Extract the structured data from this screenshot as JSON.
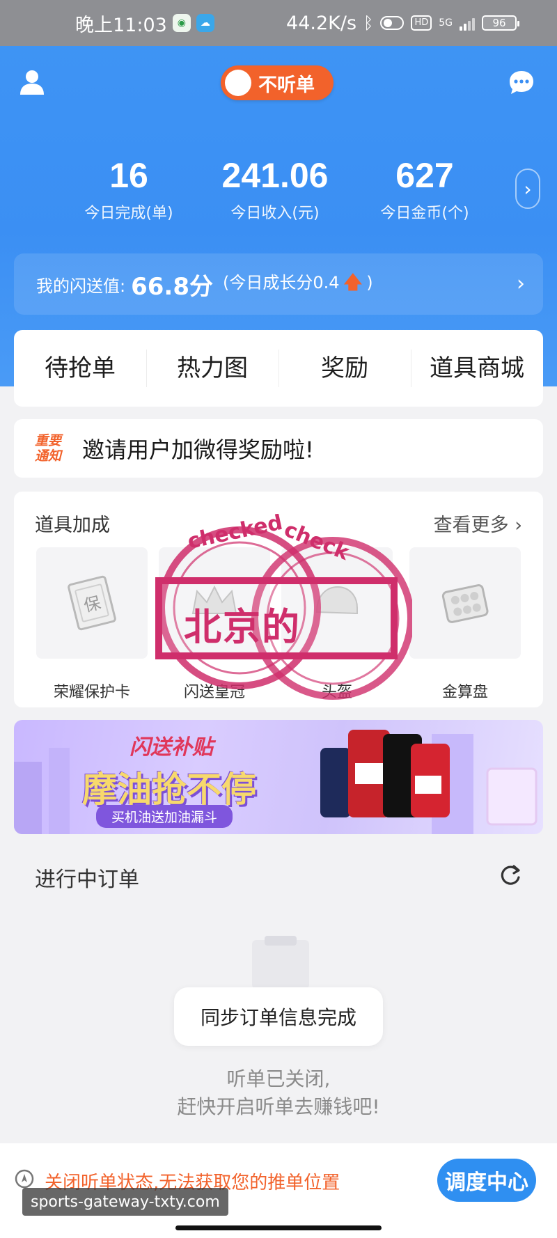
{
  "status_bar": {
    "time": "晚上11:03",
    "network_speed": "44.2K/s",
    "hd_badge": "HD",
    "signal_label": "5G",
    "battery": "96"
  },
  "header": {
    "listen_toggle_label": "不听单"
  },
  "stats": [
    {
      "value": "16",
      "label": "今日完成(单)"
    },
    {
      "value": "241.06",
      "label": "今日收入(元)"
    },
    {
      "value": "627",
      "label": "今日金币(个)"
    }
  ],
  "score": {
    "label": "我的闪送值:",
    "value": "66.8分",
    "growth_prefix": "(今日成长分0.4",
    "growth_suffix": ")"
  },
  "menu": [
    {
      "label": "待抢单"
    },
    {
      "label": "热力图"
    },
    {
      "label": "奖励"
    },
    {
      "label": "道具商城"
    }
  ],
  "notice": {
    "tag_line1": "重要",
    "tag_line2": "通知",
    "text": "邀请用户加微得奖励啦!"
  },
  "props": {
    "title": "道具加成",
    "more": "查看更多",
    "items": [
      {
        "name": "荣耀保护卡",
        "icon": "protection-card-icon"
      },
      {
        "name": "闪送皇冠",
        "icon": "crown-icon"
      },
      {
        "name": "头盔",
        "icon": "helmet-icon"
      },
      {
        "name": "金算盘",
        "icon": "abacus-icon"
      }
    ]
  },
  "stamp": {
    "text": "北京的",
    "ring_text": "checked"
  },
  "banner": {
    "subtitle_top": "闪送补贴",
    "title": "摩油抢不停",
    "subtitle": "买机油送加油漏斗"
  },
  "orders": {
    "title": "进行中订单",
    "toast": "同步订单信息完成",
    "empty_line1": "听单已关闭,",
    "empty_line2": "赶快开启听单去赚钱吧!"
  },
  "footer": {
    "warning": "关闭听单状态,无法获取您的推单位置",
    "dispatch_button": "调度中心"
  },
  "watermark": "sports-gateway-txty.com",
  "colors": {
    "primary_blue": "#3b8ff3",
    "accent_orange": "#f2622b",
    "stamp_red": "#cf2e6b"
  }
}
